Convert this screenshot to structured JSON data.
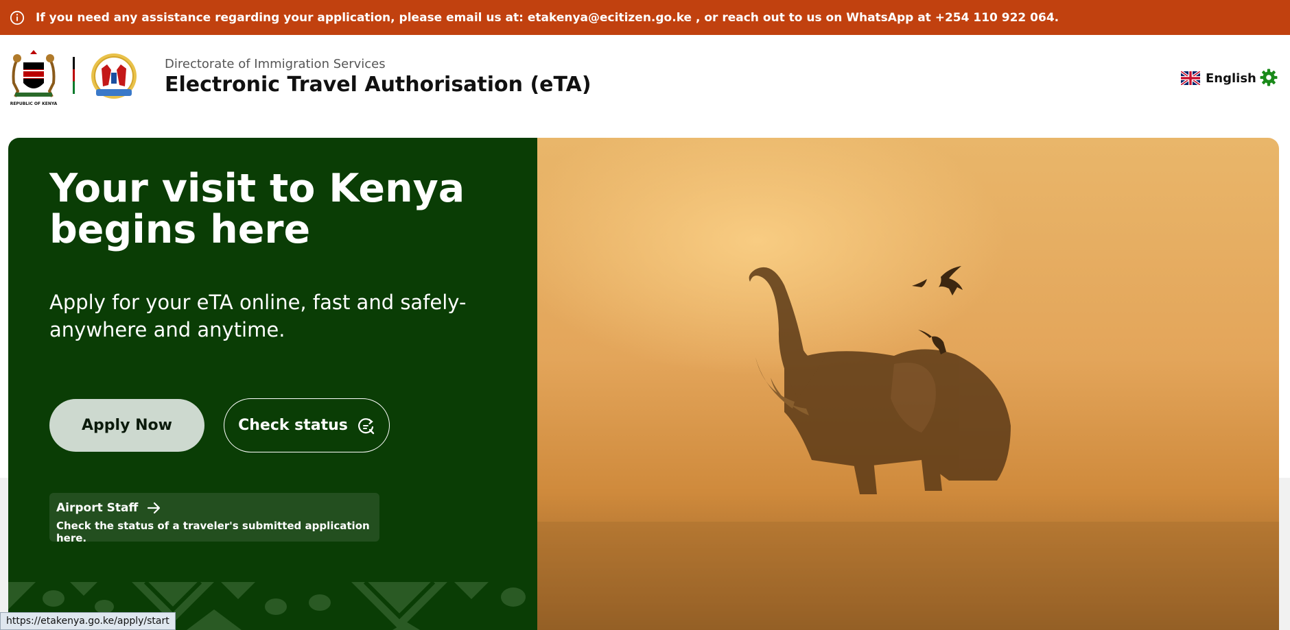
{
  "banner": {
    "icon": "info-icon",
    "text": "If you need any assistance regarding your application, please email us at: etakenya@ecitizen.go.ke , or reach out to us on WhatsApp at +254 110 922 064."
  },
  "header": {
    "coat_of_arms_caption": "REPUBLIC OF KENYA",
    "subtitle": "Directorate of Immigration Services",
    "title": "Electronic Travel Authorisation (eTA)",
    "language": "English",
    "settings_icon": "gear-icon"
  },
  "hero": {
    "headline_line1": "Your visit to Kenya",
    "headline_line2": "begins here",
    "lead": "Apply for your eTA online, fast and safely- anywhere and anytime.",
    "apply_label": "Apply Now",
    "status_label": "Check status",
    "staff_title": "Airport Staff",
    "staff_desc": "Check the status of a traveler's submitted application here."
  },
  "status_bar_url": "https://etakenya.go.ke/apply/start",
  "colors": {
    "banner": "#c1410f",
    "hero_green": "#0a3d05",
    "apply_button": "#cdd9cf",
    "staff_card": "#234f1f",
    "gear": "#1a8a1a"
  }
}
